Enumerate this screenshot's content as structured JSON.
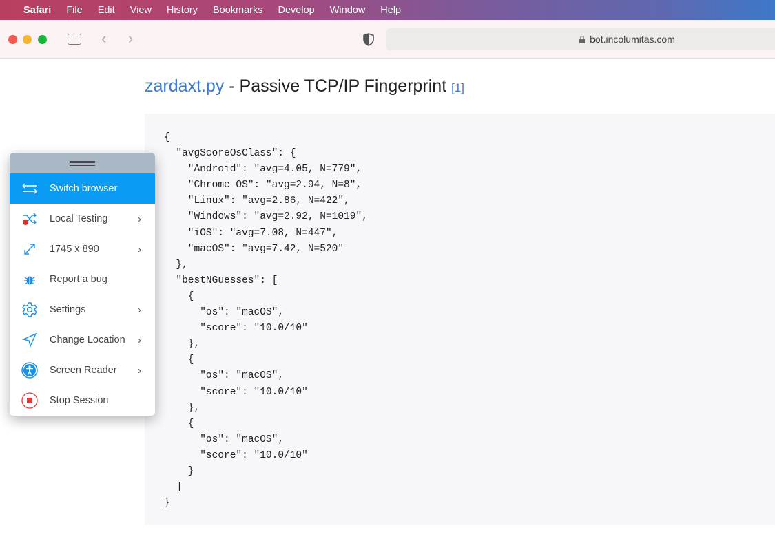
{
  "menubar": {
    "items": [
      "Safari",
      "File",
      "Edit",
      "View",
      "History",
      "Bookmarks",
      "Develop",
      "Window",
      "Help"
    ]
  },
  "toolbar": {
    "url": "bot.incolumitas.com"
  },
  "page": {
    "title_link": "zardaxt.py",
    "title_rest": " - Passive TCP/IP Fingerprint ",
    "ref": "[1]"
  },
  "code_lines": [
    "{",
    "  \"avgScoreOsClass\": {",
    "    \"Android\": \"avg=4.05, N=779\",",
    "    \"Chrome OS\": \"avg=2.94, N=8\",",
    "    \"Linux\": \"avg=2.86, N=422\",",
    "    \"Windows\": \"avg=2.92, N=1019\",",
    "    \"iOS\": \"avg=7.08, N=447\",",
    "    \"macOS\": \"avg=7.42, N=520\"",
    "  },",
    "  \"bestNGuesses\": [",
    "    {",
    "      \"os\": \"macOS\",",
    "      \"score\": \"10.0/10\"",
    "    },",
    "    {",
    "      \"os\": \"macOS\",",
    "      \"score\": \"10.0/10\"",
    "    },",
    "    {",
    "      \"os\": \"macOS\",",
    "      \"score\": \"10.0/10\"",
    "    }",
    "  ]",
    "}"
  ],
  "panel": {
    "items": [
      {
        "label": "Switch browser",
        "icon": "switch-icon",
        "active": true
      },
      {
        "label": "Local Testing",
        "icon": "shuffle-icon",
        "chevron": true
      },
      {
        "label": "1745 x 890",
        "icon": "resize-icon",
        "chevron": true
      },
      {
        "label": "Report a bug",
        "icon": "bug-icon"
      },
      {
        "label": "Settings",
        "icon": "gear-icon",
        "chevron": true
      },
      {
        "label": "Change Location",
        "icon": "location-arrow-icon",
        "chevron": true
      },
      {
        "label": "Screen Reader",
        "icon": "accessibility-icon",
        "chevron": true
      },
      {
        "label": "Stop Session",
        "icon": "stop-icon"
      }
    ]
  },
  "colors": {
    "accent": "#0a9bf5",
    "icon_blue": "#1a8fe8",
    "stop_red": "#e03a3a"
  }
}
